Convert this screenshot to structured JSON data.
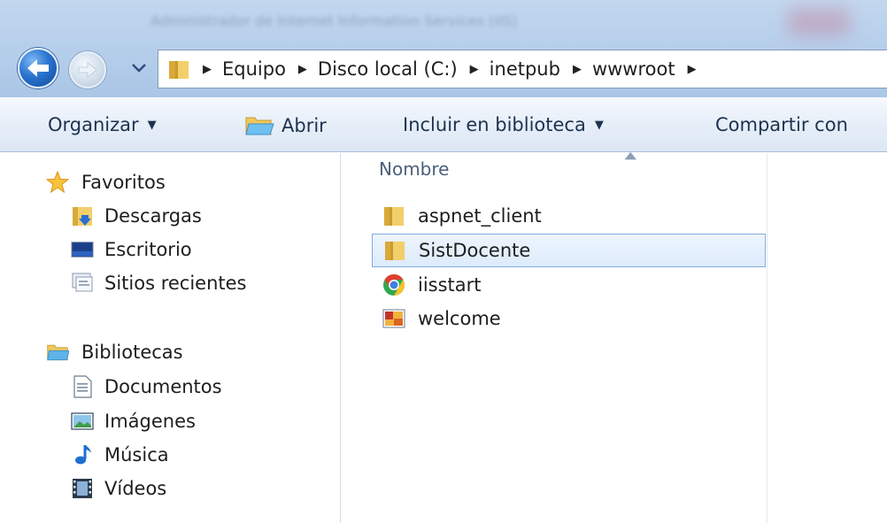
{
  "window": {
    "title": "Administrador de Internet Information Services (IIS)"
  },
  "navigation": {
    "back_icon": "back-arrow-icon",
    "forward_icon": "forward-arrow-icon",
    "recent_icon": "chevron-down-icon"
  },
  "address": {
    "root_icon": "folder-icon",
    "breadcrumbs": [
      "Equipo",
      "Disco local (C:)",
      "inetpub",
      "wwwroot"
    ]
  },
  "commandbar": {
    "organize_label": "Organizar",
    "open_label": "Abrir",
    "include_label": "Incluir en biblioteca",
    "share_label": "Compartir con"
  },
  "sidebar": {
    "favorites": {
      "label": "Favoritos",
      "icon": "star-icon",
      "items": [
        {
          "label": "Descargas",
          "icon": "downloads-folder-icon"
        },
        {
          "label": "Escritorio",
          "icon": "desktop-icon"
        },
        {
          "label": "Sitios recientes",
          "icon": "recent-places-icon"
        }
      ]
    },
    "libraries": {
      "label": "Bibliotecas",
      "icon": "library-icon",
      "items": [
        {
          "label": "Documentos",
          "icon": "document-icon"
        },
        {
          "label": "Imágenes",
          "icon": "picture-icon"
        },
        {
          "label": "Música",
          "icon": "music-note-icon"
        },
        {
          "label": "Vídeos",
          "icon": "video-film-icon"
        }
      ]
    }
  },
  "filelist": {
    "column_header": "Nombre",
    "sort": "ascending",
    "files": [
      {
        "name": "aspnet_client",
        "icon": "folder-icon",
        "selected": false
      },
      {
        "name": "SistDocente",
        "icon": "folder-icon",
        "selected": true
      },
      {
        "name": "iisstart",
        "icon": "chrome-icon",
        "selected": false
      },
      {
        "name": "welcome",
        "icon": "image-file-icon",
        "selected": false
      }
    ]
  },
  "colors": {
    "titlebar": "#b8d0ec",
    "selection": "#dcebfc",
    "selection_border": "#84acdd",
    "folder": "#e8c15a"
  }
}
